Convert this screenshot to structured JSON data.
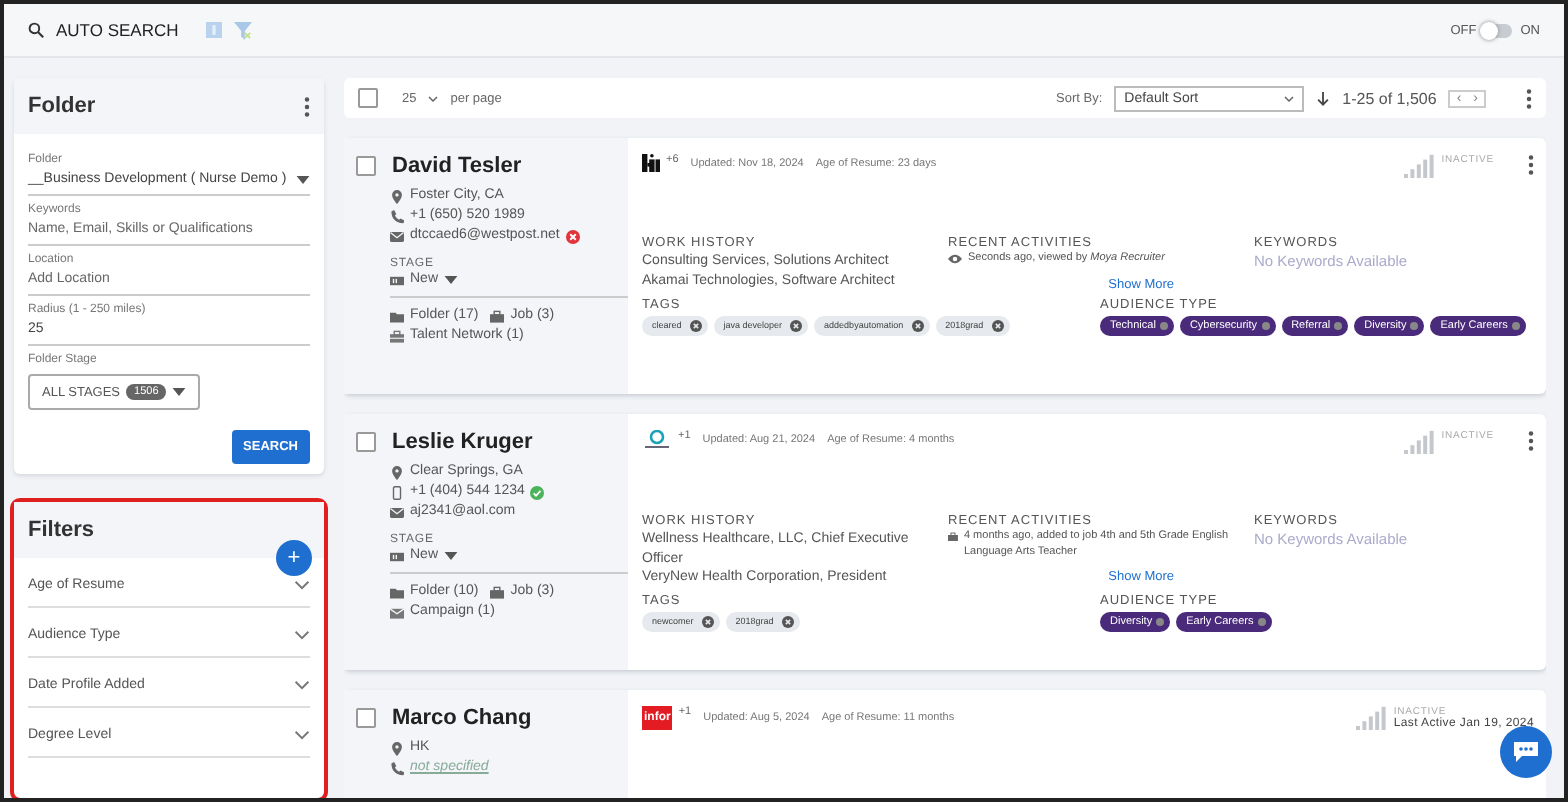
{
  "top_bar": {
    "title": "AUTO SEARCH",
    "toggle": {
      "off_label": "OFF",
      "on_label": "ON",
      "on": false
    }
  },
  "folder_panel": {
    "title": "Folder",
    "fields": [
      {
        "kind": "select",
        "label": "Folder",
        "value": "__Business Development ( Nurse Demo )"
      },
      {
        "kind": "text",
        "label": "Keywords",
        "placeholder": "Name, Email, Skills or Qualifications"
      },
      {
        "kind": "text",
        "label": "Location",
        "placeholder": "Add Location"
      },
      {
        "kind": "text",
        "label": "Radius (1 - 250 miles)",
        "value": "25"
      }
    ],
    "stage": {
      "label": "Folder Stage",
      "value": "ALL STAGES",
      "count": "1506"
    },
    "search_button": "SEARCH"
  },
  "filters_panel": {
    "title": "Filters",
    "highlighted": true,
    "add_button": "+",
    "items": [
      {
        "label": "Age of Resume",
        "expanded": false
      },
      {
        "label": "Audience Type",
        "expanded": false
      },
      {
        "label": "Date Profile Added",
        "expanded": false
      },
      {
        "label": "Degree Level",
        "expanded": false
      }
    ]
  },
  "toolbar": {
    "selected": false,
    "per_page": "25",
    "per_page_label": "per page",
    "sort_label": "Sort By:",
    "sort_value": "Default Sort",
    "range": "1-25 of 1,506",
    "prev": "‹",
    "next": "›"
  },
  "candidates": [
    {
      "name": "David Tesler",
      "selected": false,
      "location": "Foster City, CA",
      "phone": {
        "kind": "landline",
        "text": "+1 (650) 520 1989"
      },
      "email": {
        "text": "dtccaed6@westpost.net",
        "verified": false
      },
      "stage_label": "STAGE",
      "stage": "New",
      "links": [
        {
          "kind": "folder",
          "text": "Folder (17)"
        },
        {
          "kind": "job",
          "text": "Job (3)"
        },
        {
          "kind": "network",
          "text": "Talent Network (1)"
        }
      ],
      "source": {
        "kind": "glyph",
        "extra": "+6"
      },
      "updated": "Updated: Nov 18, 2024",
      "age": "Age of Resume: 23 days",
      "status": "INACTIVE",
      "labels": {
        "work": "WORK HISTORY",
        "activity": "RECENT ACTIVITIES",
        "keywords": "KEYWORDS",
        "tags": "TAGS",
        "audience": "AUDIENCE TYPE"
      },
      "work_history": [
        "Consulting Services, Solutions Architect",
        "Akamai Technologies, Software Architect"
      ],
      "activity": {
        "kind": "view",
        "text": "Seconds ago, viewed by *Moya Recruiter*"
      },
      "show_more": "Show More",
      "keywords": "No Keywords Available",
      "tags": [
        "cleared",
        "java developer",
        "addedbyautomation",
        "2018grad"
      ],
      "audience": [
        "Technical",
        "Cybersecurity",
        "Referral",
        "Diversity",
        "Early Careers"
      ]
    },
    {
      "name": "Leslie Kruger",
      "selected": false,
      "location": "Clear Springs, GA",
      "phone": {
        "kind": "mobile",
        "text": "+1 (404) 544 1234",
        "verified": true
      },
      "email": {
        "text": "aj2341@aol.com"
      },
      "stage_label": "STAGE",
      "stage": "New",
      "links": [
        {
          "kind": "folder",
          "text": "Folder (10)"
        },
        {
          "kind": "job",
          "text": "Job (3)"
        },
        {
          "kind": "campaign",
          "text": "Campaign (1)"
        }
      ],
      "source": {
        "kind": "drop",
        "extra": "+1"
      },
      "updated": "Updated: Aug 21, 2024",
      "age": "Age of Resume: 4 months",
      "status": "INACTIVE",
      "labels": {
        "work": "WORK HISTORY",
        "activity": "RECENT ACTIVITIES",
        "keywords": "KEYWORDS",
        "tags": "TAGS",
        "audience": "AUDIENCE TYPE"
      },
      "work_history": [
        "Wellness Healthcare, LLC, Chief Executive Officer",
        "VeryNew Health Corporation, President"
      ],
      "activity": {
        "kind": "job",
        "text": "4 months ago, added to job 4th and 5th Grade English Language Arts Teacher"
      },
      "show_more": "Show More",
      "keywords": "No Keywords Available",
      "tags": [
        "newcomer",
        "2018grad"
      ],
      "audience": [
        "Diversity",
        "Early Careers"
      ]
    },
    {
      "name": "Marco Chang",
      "selected": false,
      "location": "HK",
      "phone": {
        "kind": "landline",
        "text": "not specified",
        "missing": true
      },
      "source": {
        "kind": "badge",
        "text": "infor",
        "extra": "+1"
      },
      "updated": "Updated: Aug 5, 2024",
      "age": "Age of Resume: 11 months",
      "status": "INACTIVE",
      "last_active": "Last Active Jan 19, 2024"
    }
  ]
}
